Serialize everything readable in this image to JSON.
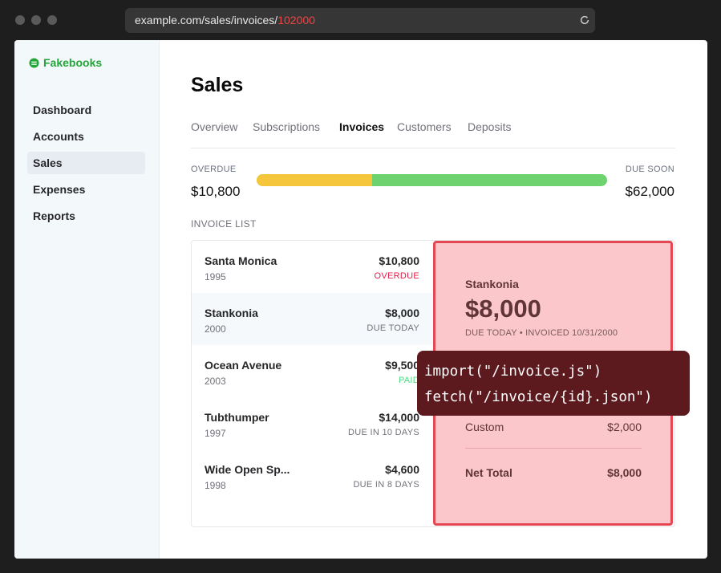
{
  "browser": {
    "url_prefix": "example.com/sales/invoices/",
    "url_id": "102000"
  },
  "sidebar": {
    "brand": "Fakebooks",
    "items": [
      {
        "label": "Dashboard"
      },
      {
        "label": "Accounts"
      },
      {
        "label": "Sales"
      },
      {
        "label": "Expenses"
      },
      {
        "label": "Reports"
      }
    ]
  },
  "main": {
    "title": "Sales",
    "tabs": [
      {
        "label": "Overview"
      },
      {
        "label": "Subscriptions"
      },
      {
        "label": "Invoices"
      },
      {
        "label": "Customers"
      },
      {
        "label": "Deposits"
      }
    ],
    "overview": {
      "overdue_label": "OVERDUE",
      "overdue_value": "$10,800",
      "due_soon_label": "DUE SOON",
      "due_soon_value": "$62,000",
      "overdue_fraction": 0.33
    },
    "invoice_list_label": "INVOICE LIST",
    "invoices": [
      {
        "name": "Santa Monica",
        "year": "1995",
        "amount": "$10,800",
        "status": "OVERDUE"
      },
      {
        "name": "Stankonia",
        "year": "2000",
        "amount": "$8,000",
        "status": "DUE TODAY"
      },
      {
        "name": "Ocean Avenue",
        "year": "2003",
        "amount": "$9,500",
        "status": "PAID"
      },
      {
        "name": "Tubthumper",
        "year": "1997",
        "amount": "$14,000",
        "status": "DUE IN 10 DAYS"
      },
      {
        "name": "Wide Open Sp...",
        "year": "1998",
        "amount": "$4,600",
        "status": "DUE IN 8 DAYS"
      }
    ],
    "detail": {
      "name": "Stankonia",
      "amount": "$8,000",
      "meta": "DUE TODAY • INVOICED 10/31/2000",
      "line_label": "Custom",
      "line_value": "$2,000",
      "total_label": "Net Total",
      "total_value": "$8,000"
    },
    "code_overlay": {
      "line1": "import(\"/invoice.js\")",
      "line2": "fetch(\"/invoice/{id}.json\")"
    }
  },
  "colors": {
    "brand": "#22a638",
    "overdue_bar": "#f5c63c",
    "due_soon_bar": "#6ed26e",
    "detail_bg": "#fbc7ca",
    "detail_border": "#e54853",
    "code_bg": "#5c1a1f"
  }
}
